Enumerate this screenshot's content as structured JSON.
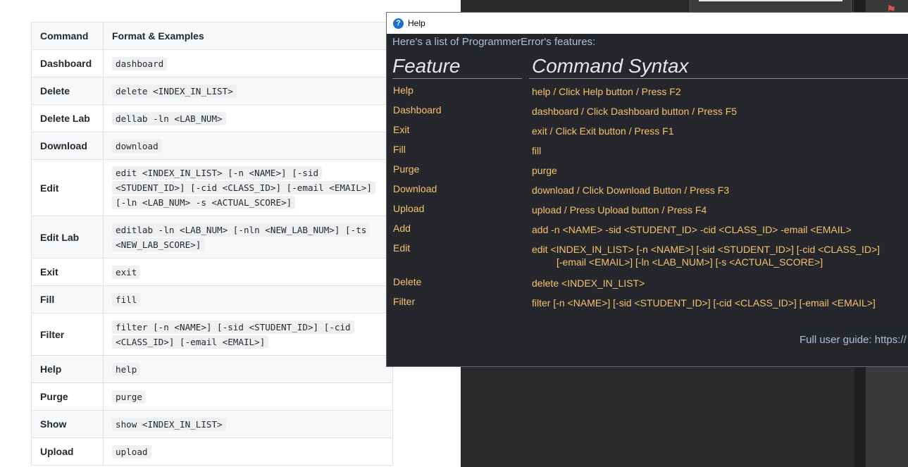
{
  "doc_table": {
    "headers": [
      "Command",
      "Format & Examples"
    ],
    "rows": [
      {
        "command": "Dashboard",
        "format": "dashboard"
      },
      {
        "command": "Delete",
        "format": "delete <INDEX_IN_LIST>"
      },
      {
        "command": "Delete Lab",
        "format": "dellab -ln <LAB_NUM>"
      },
      {
        "command": "Download",
        "format": "download"
      },
      {
        "command": "Edit",
        "format": "edit <INDEX_IN_LIST> [-n <NAME>] [-sid <STUDENT_ID>] [-cid <CLASS_ID>] [-email <EMAIL>] [-ln <LAB_NUM> -s <ACTUAL_SCORE>]"
      },
      {
        "command": "Edit Lab",
        "format": "editlab -ln <LAB_NUM> [-nln <NEW_LAB_NUM>] [-ts <NEW_LAB_SCORE>]"
      },
      {
        "command": "Exit",
        "format": "exit"
      },
      {
        "command": "Fill",
        "format": "fill"
      },
      {
        "command": "Filter",
        "format": "filter [-n <NAME>] [-sid <STUDENT_ID>] [-cid <CLASS_ID>] [-email <EMAIL>]"
      },
      {
        "command": "Help",
        "format": "help"
      },
      {
        "command": "Purge",
        "format": "purge"
      },
      {
        "command": "Show",
        "format": "show <INDEX_IN_LIST>"
      },
      {
        "command": "Upload",
        "format": "upload"
      }
    ]
  },
  "help_window": {
    "title": "Help",
    "title_icon": "question-icon",
    "intro": "Here's a list of ProgrammerError's features:",
    "feature_header": "Feature",
    "syntax_header": "Command Syntax",
    "features": [
      {
        "name": "Help",
        "syntax": "help / Click Help button / Press F2"
      },
      {
        "name": "Dashboard",
        "syntax": "dashboard / Click Dashboard button / Press F5"
      },
      {
        "name": "Exit",
        "syntax": "exit / Click Exit button / Press F1"
      },
      {
        "name": "Fill",
        "syntax": "fill"
      },
      {
        "name": "Purge",
        "syntax": "purge"
      },
      {
        "name": "Download",
        "syntax": "download / Click Download Button / Press F3"
      },
      {
        "name": "Upload",
        "syntax": "upload / Press Upload button / Press F4"
      },
      {
        "name": "Add",
        "syntax": "add  -n <NAME>  -sid <STUDENT_ID>  -cid <CLASS_ID>  -email <EMAIL>"
      },
      {
        "name": "Edit",
        "syntax": "edit  <INDEX_IN_LIST>  [-n <NAME>]  [-sid <STUDENT_ID>]  [-cid <CLASS_ID>]",
        "syntax_cont": "[-email <EMAIL>]  [-ln <LAB_NUM>]  [-s <ACTUAL_SCORE>]"
      },
      {
        "name": "Delete",
        "syntax": "delete  <INDEX_IN_LIST>"
      },
      {
        "name": "Filter",
        "syntax": "filter  [-n <NAME>]  [-sid <STUDENT_ID>]  [-cid <CLASS_ID>]  [-email <EMAIL>]"
      }
    ],
    "footer": "Full user guide: https://"
  },
  "colors": {
    "help_bg": "#25272c",
    "feature_text": "#f5c26b",
    "intro_text": "#a8bfd8",
    "app_bg": "#2b2b2b"
  }
}
